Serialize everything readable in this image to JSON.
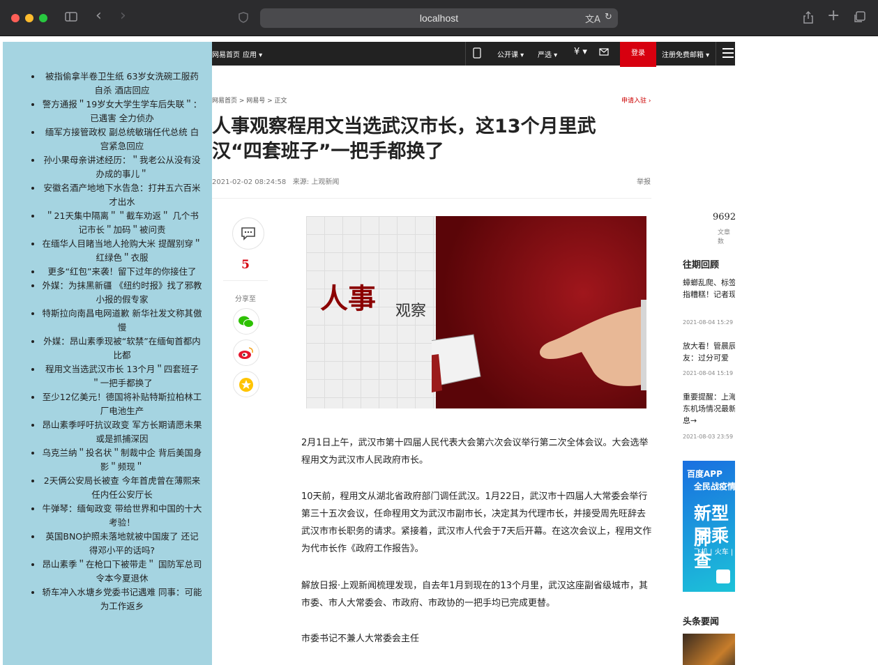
{
  "browser": {
    "address": "localhost"
  },
  "sidebar": {
    "items": [
      "被指偷拿半卷卫生纸 63岁女洗碗工服药自杀 酒店回应",
      "警方通报＂19岁女大学生学车后失联＂：已遇害 全力侦办",
      "缅军方接管政权 副总统敏瑞任代总统 白宫紧急回应",
      "孙小果母亲讲述经历：＂我老公从没有没办成的事儿＂",
      "安徽名酒产地地下水告急：打井五六百米才出水",
      "＂21天集中隔离＂＂截车劝返＂ 几个书记市长＂加码＂被问责",
      "在缅华人目睹当地人抢购大米 提醒别穿＂红绿色＂衣服",
      "更多“红包”来袭！留下过年的你接住了",
      "外媒：为抹黑新疆 《纽约时报》找了邪教小报的假专家",
      "特斯拉向南昌电网道歉 新华社发文称其傲慢",
      "外媒：昂山素季现被“软禁”在缅甸首都内比都",
      "程用文当选武汉市长 13个月＂四套班子＂一把手都换了",
      "至少12亿美元！德国将补贴特斯拉柏林工厂电池生产",
      "昂山素季呼吁抗议政变 军方长期请愿未果或是抓捕深因",
      "乌克兰纳＂投名状＂制裁中企 背后美国身影＂频现＂",
      "2天俩公安局长被查 今年首虎曾在薄熙来任内任公安厅长",
      "牛弹琴：缅甸政变 带给世界和中国的十大考验！",
      "英国BNO护照未落地就被中国废了 还记得邓小平的话吗?",
      "昂山素季＂在枪口下被带走＂ 国防军总司令本今夏退休",
      "轿车冲入水塘乡党委书记遇难 同事：可能为工作返乡"
    ]
  },
  "topnav": {
    "home": "网易首页",
    "apps": "应用",
    "open_course": "公开课",
    "yanxuan": "严选",
    "login": "登录",
    "register_mail": "注册免费邮箱"
  },
  "article": {
    "breadcrumb": "网易首页 > 网易号 > 正文",
    "apply": "申请入驻",
    "title": "人事观察程用文当选武汉市长，这13个月里武汉“四套班子”一把手都换了",
    "date": "2021-02-02 08:24:58",
    "source": "来源: 上观新闻",
    "report": "举报",
    "comment_count": "5",
    "share_label": "分享至",
    "hero_big": "人事",
    "hero_small": "观察",
    "paragraphs": [
      "2月1日上午，武汉市第十四届人民代表大会第六次会议举行第二次全体会议。大会选举程用文为武汉市人民政府市长。",
      "10天前，程用文从湖北省政府部门调任武汉。1月22日，武汉市十四届人大常委会举行第三十五次会议，任命程用文为武汉市副市长，决定其为代理市长，并接受周先旺辞去武汉市市长职务的请求。紧接着，武汉市人代会于7天后开幕。在这次会议上，程用文作为代市长作《政府工作报告》。",
      "解放日报·上观新闻梳理发现，自去年1月到现在的13个月里，武汉这座副省级城市，其市委、市人大常委会、市政府、市政协的一把手均已完成更替。",
      "市委书记不兼人大常委会主任"
    ]
  },
  "rail": {
    "count": "9692",
    "count_label": "文章数",
    "past_heading": "往期回顾",
    "items": [
      {
        "text": "蟑螂乱爬、标签被指糟糕！记者现...",
        "date": "2021-08-04 15:29"
      },
      {
        "text": "放大看！管晨辰友：过分可爱",
        "date": "2021-08-04 15:19"
      },
      {
        "text": "重要提醒：上海浦东机场情况最新消息→",
        "date": "2021-08-03 23:59"
      }
    ],
    "ad": {
      "brand": "百度APP",
      "line1": "全民战疫情",
      "line2": "新型肺",
      "line3": "同乘查",
      "line4": "飞机 | 火车 |"
    },
    "headlines_heading": "头条要闻"
  },
  "colors": {
    "sidebar_bg": "#a5d4e1",
    "nav_bg": "#222222",
    "login_red": "#d7000f"
  }
}
